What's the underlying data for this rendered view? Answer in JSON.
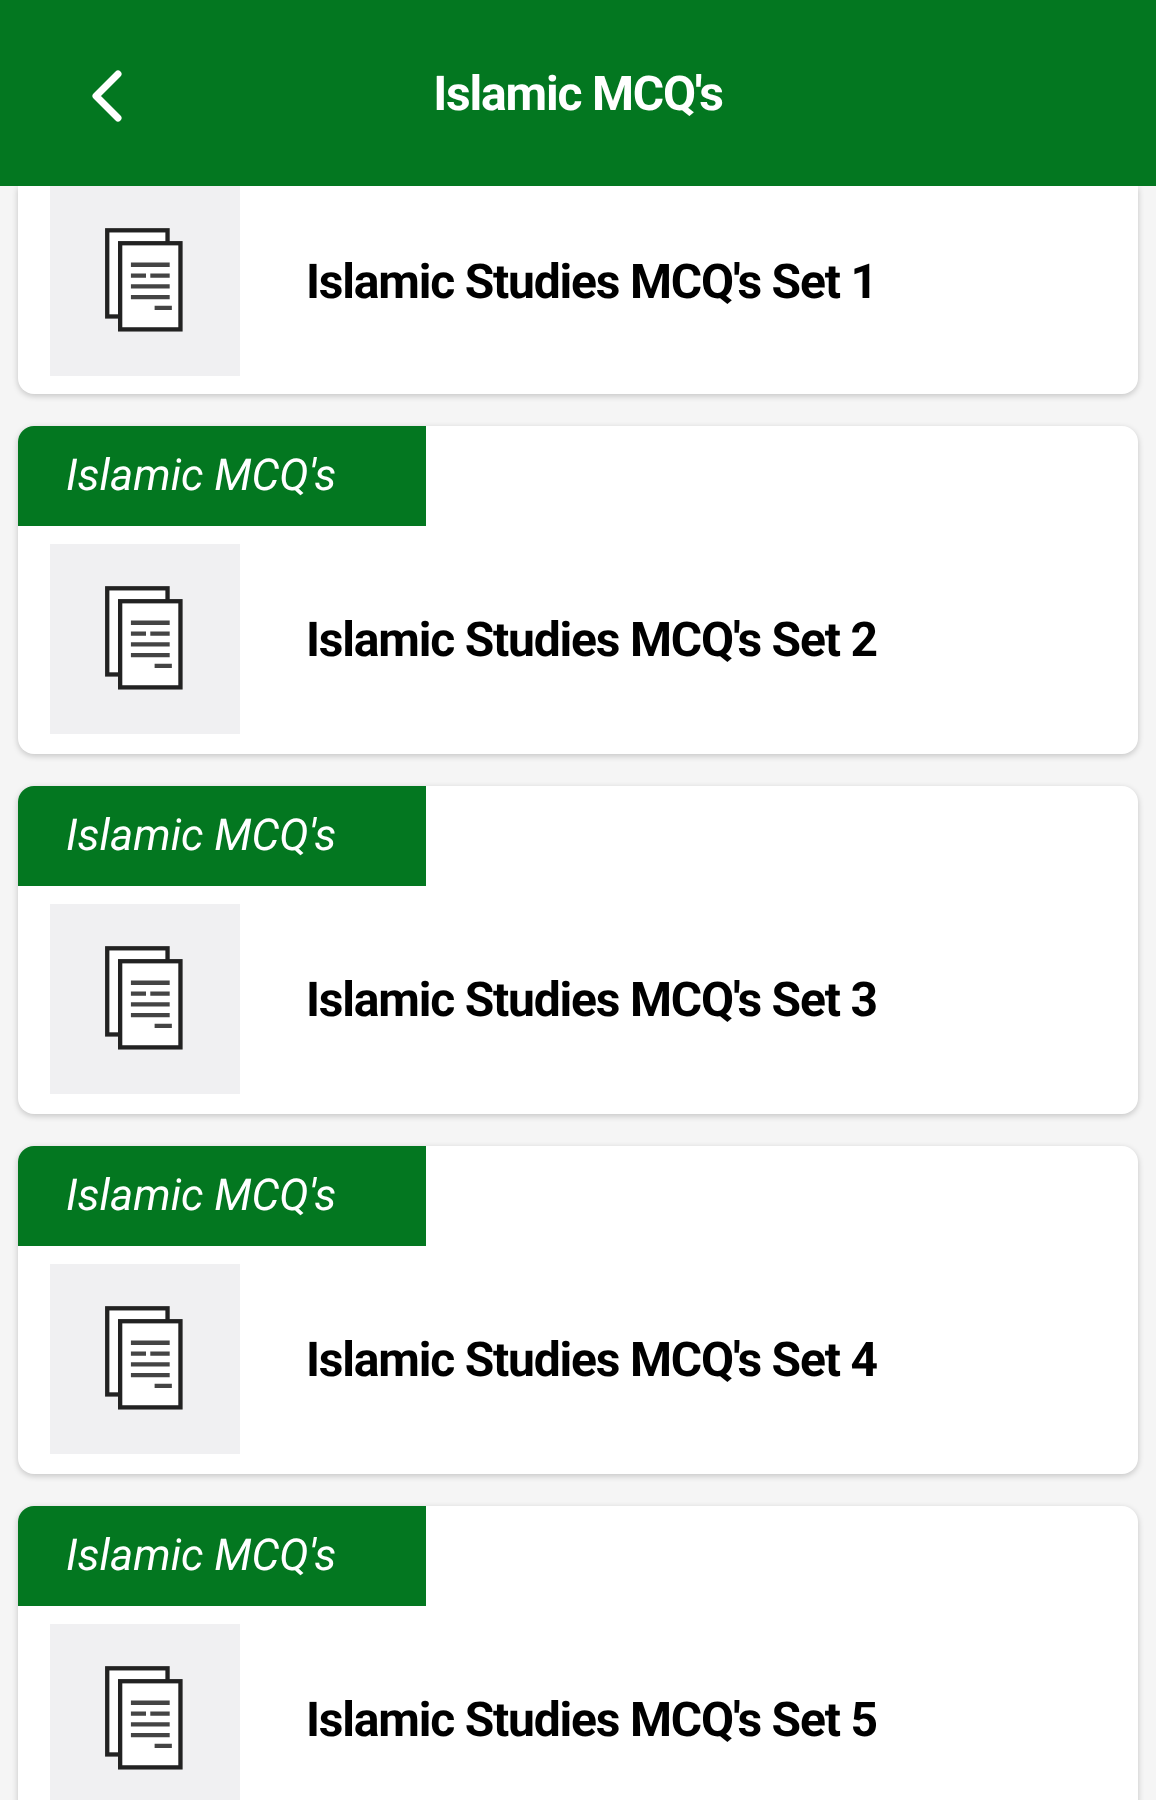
{
  "header": {
    "title": "Islamic MCQ's"
  },
  "items": [
    {
      "title": "Islamic Studies MCQ's Set 1"
    },
    {
      "tag": "Islamic MCQ's",
      "title": "Islamic Studies MCQ's Set 2"
    },
    {
      "tag": "Islamic MCQ's",
      "title": "Islamic Studies MCQ's Set 3"
    },
    {
      "tag": "Islamic MCQ's",
      "title": "Islamic Studies MCQ's Set 4"
    },
    {
      "tag": "Islamic MCQ's",
      "title": "Islamic Studies MCQ's Set 5"
    }
  ]
}
